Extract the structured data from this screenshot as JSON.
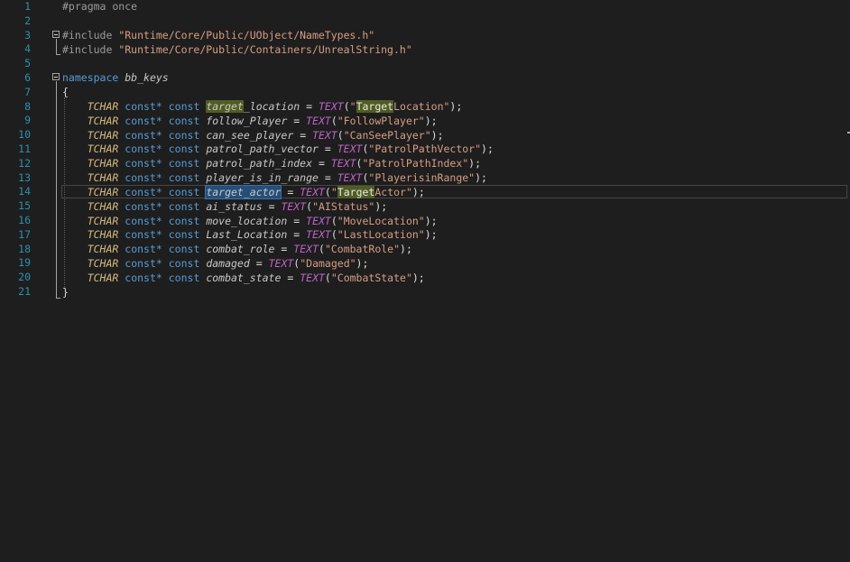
{
  "editor": {
    "line_numbers": [
      "1",
      "2",
      "3",
      "4",
      "5",
      "6",
      "7",
      "8",
      "9",
      "10",
      "11",
      "12",
      "13",
      "14",
      "15",
      "16",
      "17",
      "18",
      "19",
      "20",
      "21"
    ],
    "line1": {
      "directive": "#pragma once"
    },
    "line3": {
      "directive": "#include",
      "path": "\"Runtime/Core/Public/UObject/NameTypes.h\""
    },
    "line4": {
      "directive": "#include",
      "path": "\"Runtime/Core/Public/Containers/UnrealString.h\""
    },
    "line6": {
      "keyword": "namespace",
      "name": "bb_keys"
    },
    "open_brace": "{",
    "close_brace": "}",
    "tokens": {
      "type": "TCHAR",
      "const_ptr": "const*",
      "const": "const",
      "eq": "=",
      "macro": "TEXT",
      "open": "(",
      "close": ");"
    },
    "decls": [
      {
        "var_a": "target",
        "var_b": "_location",
        "str_open": "\"",
        "str_hl": "Target",
        "str_rest": "Location\""
      },
      {
        "var": "follow_Player",
        "value": "\"FollowPlayer\""
      },
      {
        "var": "can_see_player",
        "value": "\"CanSeePlayer\""
      },
      {
        "var": "patrol_path_vector",
        "value": "\"PatrolPathVector\""
      },
      {
        "var": "patrol_path_index",
        "value": "\"PatrolPathIndex\""
      },
      {
        "var": "player_is_in_range",
        "value": "\"PlayerisinRange\""
      },
      {
        "var": "target_actor",
        "str_open": "\"",
        "str_hl": "Target",
        "str_rest": "Actor\""
      },
      {
        "var": "ai_status",
        "value": "\"AIStatus\""
      },
      {
        "var": "move_location",
        "value": "\"MoveLocation\""
      },
      {
        "var": "Last_Location",
        "value": "\"LastLocation\""
      },
      {
        "var": "combat_role",
        "value": "\"CombatRole\""
      },
      {
        "var": "damaged",
        "value": "\"Damaged\""
      },
      {
        "var": "combat_state",
        "value": "\"CombatState\""
      }
    ]
  },
  "colors": {
    "background": "#1e1e1e",
    "line_number": "#2b91af",
    "keyword": "#569cd6",
    "string": "#d69d85",
    "macro": "#bd63c5",
    "type": "#d7ba7d",
    "reference_highlight": "#515c24",
    "selection": "#264f78"
  }
}
